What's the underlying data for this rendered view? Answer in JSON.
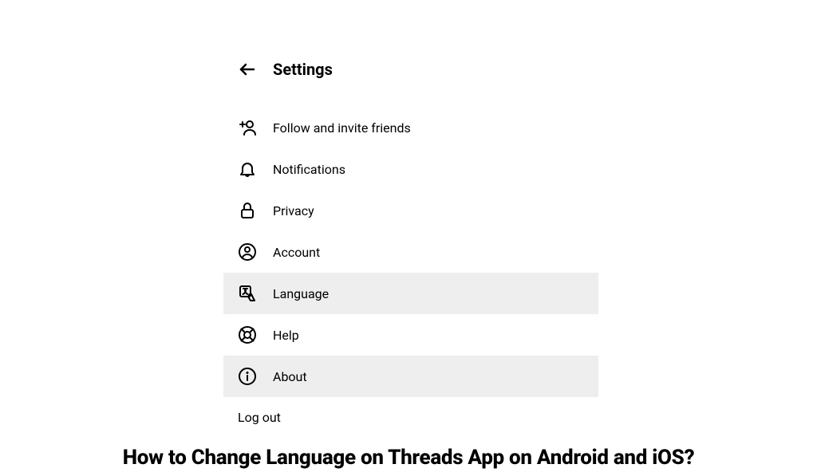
{
  "header": {
    "title": "Settings"
  },
  "menu": {
    "follow": "Follow and invite friends",
    "notifications": "Notifications",
    "privacy": "Privacy",
    "account": "Account",
    "language": "Language",
    "help": "Help",
    "about": "About",
    "logout": "Log out"
  },
  "caption": "How to Change Language on Threads App on Android and iOS?"
}
